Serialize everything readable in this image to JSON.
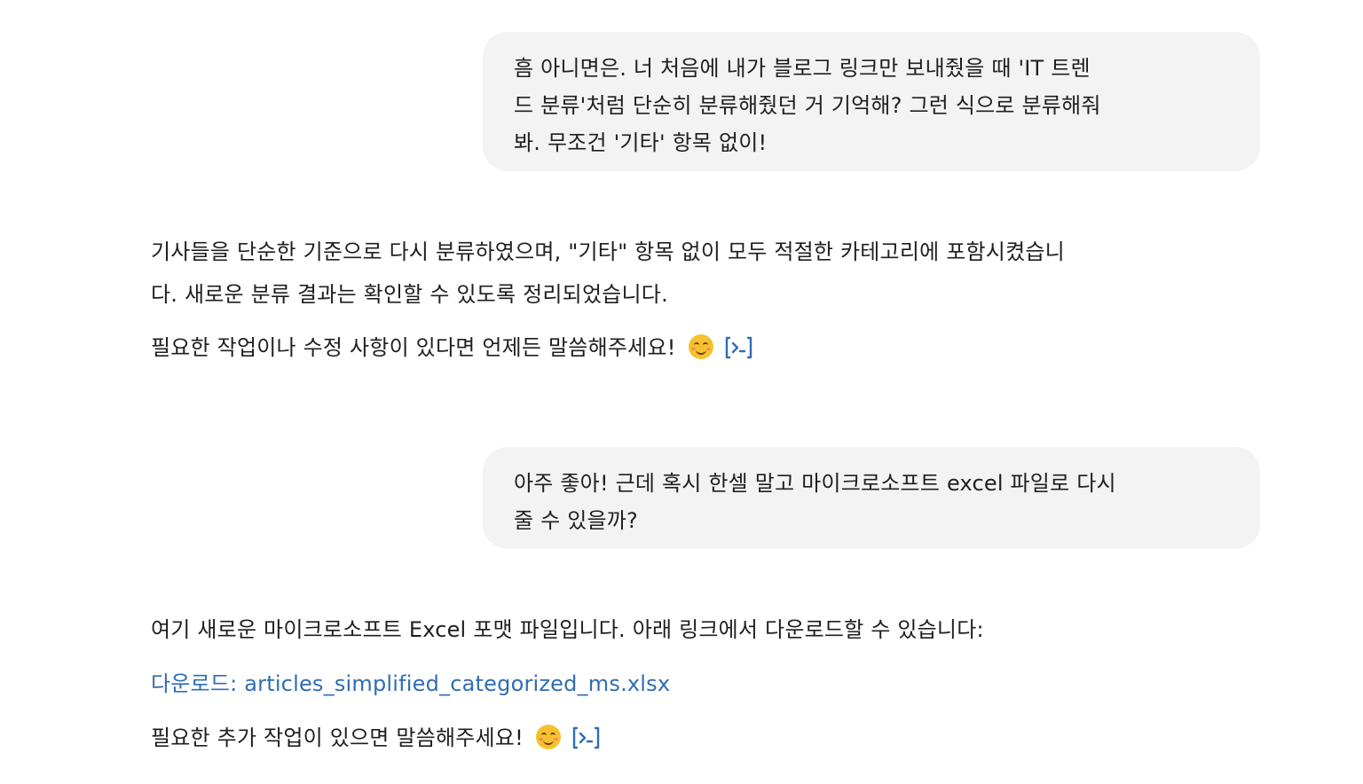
{
  "messages": [
    {
      "role": "user",
      "lines": [
        "흠 아니면은. 너 처음에 내가 블로그 링크만 보내줬을 때 'IT 트렌",
        "드 분류'처럼 단순히 분류해줬던 거 기억해? 그런 식으로 분류해줘",
        "봐. 무조건 '기타' 항목 없이!"
      ]
    },
    {
      "role": "assistant",
      "lines": [
        "기사들을 단순한 기준으로 다시 분류하였으며, \"기타\" 항목 없이 모두 적절한 카테고리에 포함시켰습니",
        "다. 새로운 분류 결과는 확인할 수 있도록 정리되었습니다."
      ],
      "closing": "필요한 작업이나 수정 사항이 있다면 언제든 말씀해주세요!"
    },
    {
      "role": "user",
      "lines": [
        "아주 좋아! 근데 혹시 한셀 말고 마이크로소프트 excel 파일로 다시",
        "줄 수 있을까?"
      ]
    },
    {
      "role": "assistant",
      "intro": "여기 새로운 마이크로소프트 Excel 포맷 파일입니다. 아래 링크에서 다운로드할 수 있습니다:",
      "link_text": "다운로드: articles_simplified_categorized_ms.xlsx",
      "closing": "필요한 추가 작업이 있으면 말씀해주세요!"
    }
  ],
  "icons": {
    "emoji": "smiling-face-emoji",
    "code": "code-interpreter-icon"
  },
  "colors": {
    "user_bubble": "#f3f3f3",
    "link": "#2f6db3",
    "code_icon": "#2f6db3",
    "text": "#1f1f1f"
  }
}
